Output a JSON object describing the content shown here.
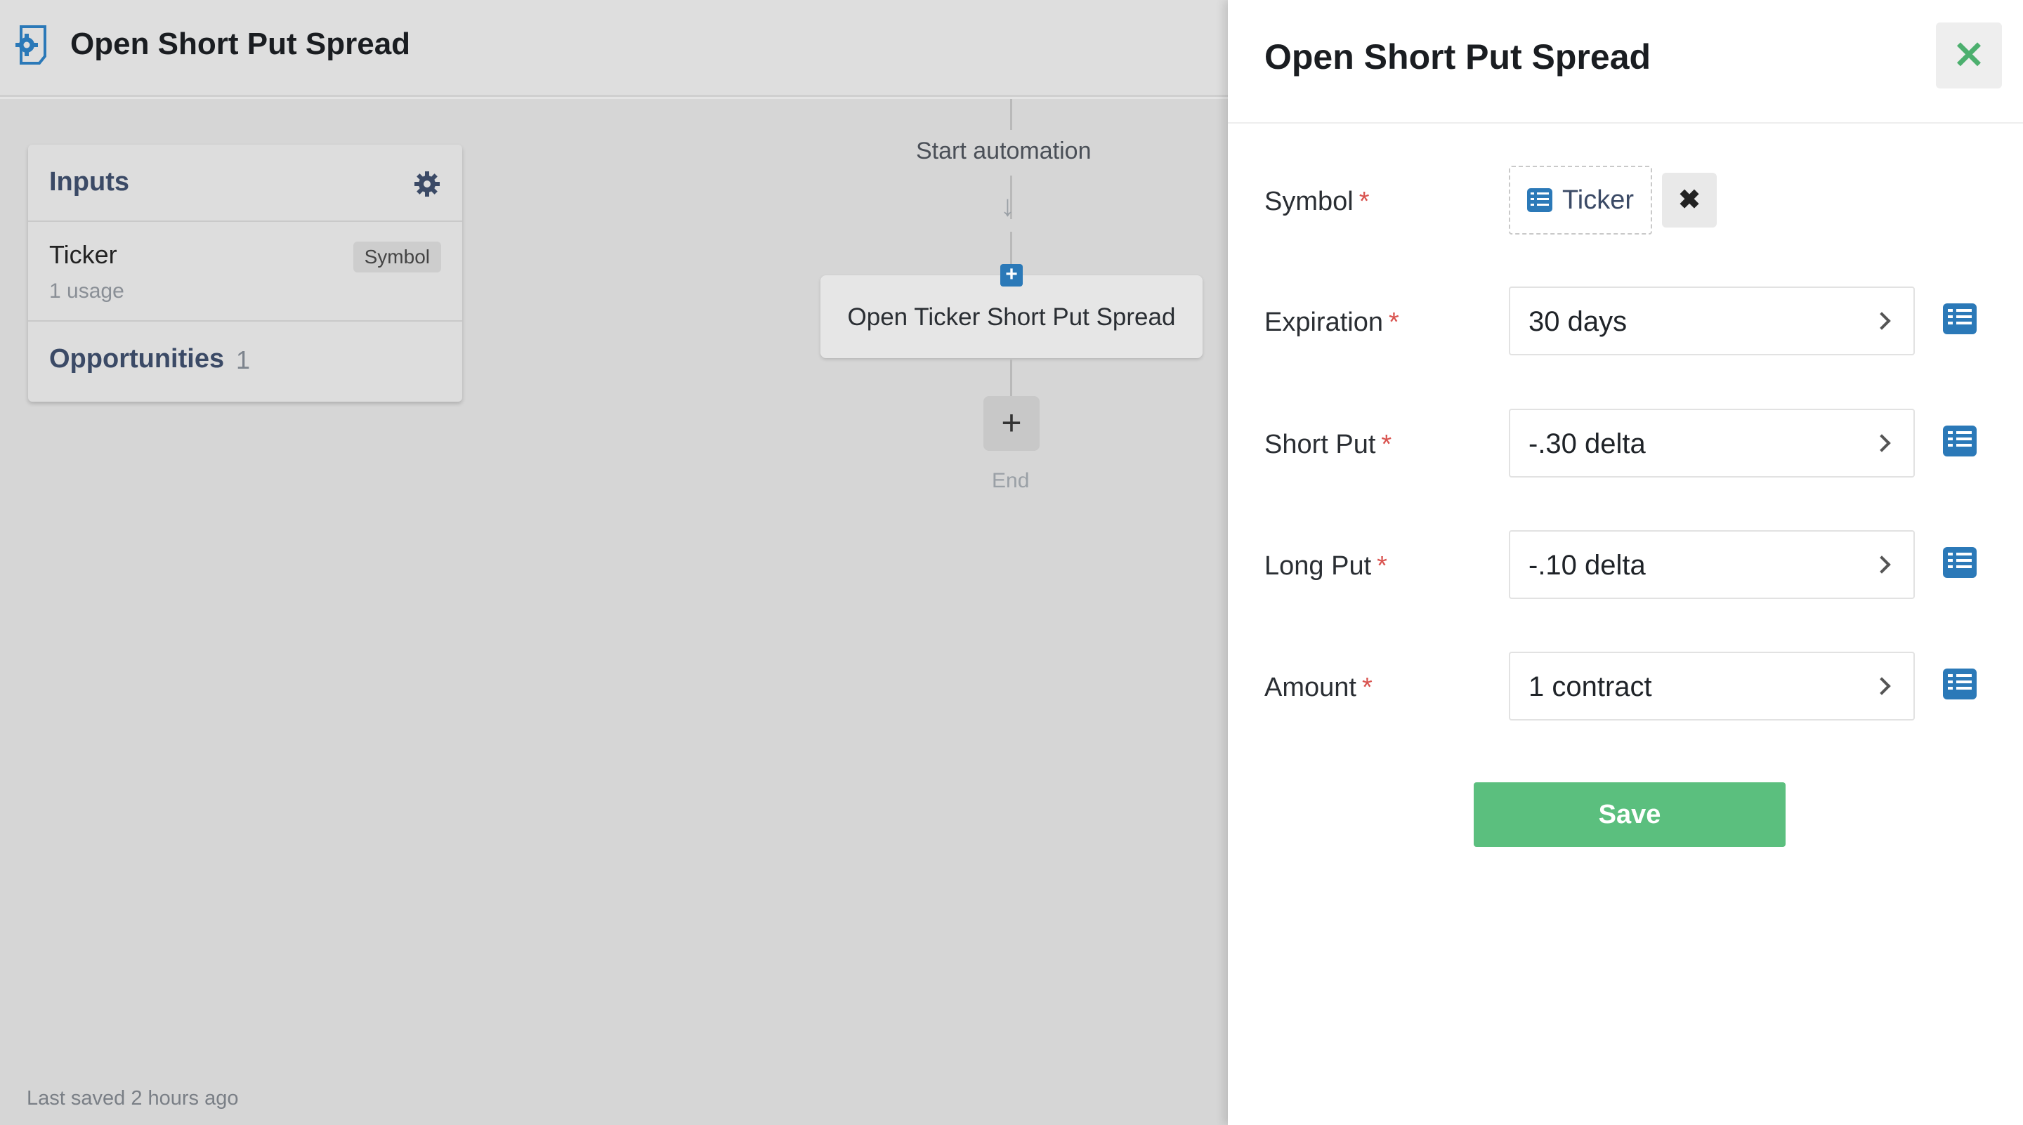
{
  "header": {
    "title": "Open Short Put Spread"
  },
  "inputs_card": {
    "title": "Inputs",
    "items": [
      {
        "name": "Ticker",
        "usage": "1 usage",
        "type": "Symbol"
      }
    ],
    "opportunities": {
      "label": "Opportunities",
      "count": "1"
    }
  },
  "flow": {
    "start_label": "Start automation",
    "step_label": "Open Ticker Short Put Spread",
    "end_label": "End"
  },
  "footer": {
    "last_saved": "Last saved 2 hours ago"
  },
  "panel": {
    "title": "Open Short Put Spread",
    "symbol": {
      "label": "Symbol",
      "required": "*",
      "value": "Ticker"
    },
    "fields": [
      {
        "label": "Expiration",
        "required": "*",
        "value": "30 days"
      },
      {
        "label": "Short Put",
        "required": "*",
        "value": "-.30 delta"
      },
      {
        "label": "Long Put",
        "required": "*",
        "value": "-.10 delta"
      },
      {
        "label": "Amount",
        "required": "*",
        "value": "1 contract"
      }
    ],
    "save_label": "Save"
  },
  "colors": {
    "accent_blue": "#2b79b8",
    "save_green": "#5bbf7e",
    "required_red": "#d9534f",
    "close_green": "#4caf6e"
  },
  "icons": {
    "logo": "automation-gear-icon",
    "settings": "gear-icon",
    "close": "close-icon",
    "remove": "remove-x-icon",
    "list": "list-icon",
    "chevron": "chevron-right-icon"
  }
}
